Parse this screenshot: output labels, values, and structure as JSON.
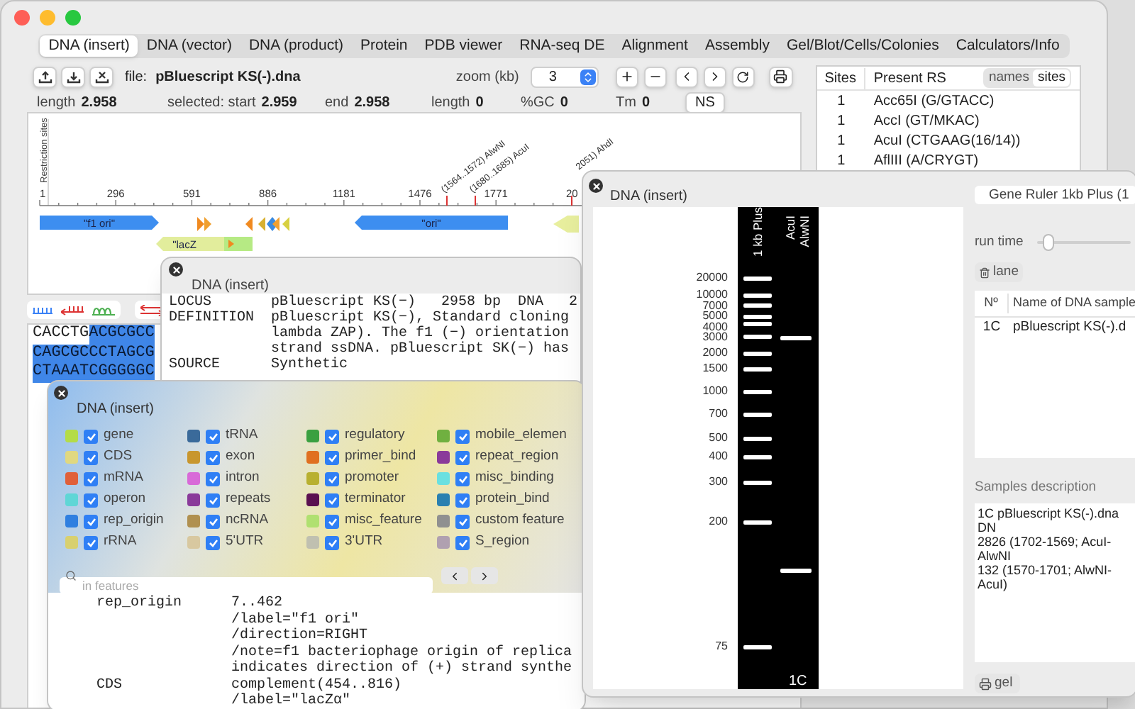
{
  "main_window": {
    "tabs": [
      {
        "label": "DNA (insert)",
        "selected": true
      },
      {
        "label": "DNA (vector)",
        "selected": false
      },
      {
        "label": "DNA (product)",
        "selected": false
      },
      {
        "label": "Protein",
        "selected": false
      },
      {
        "label": "PDB viewer",
        "selected": false
      },
      {
        "label": "RNA-seq DE",
        "selected": false
      },
      {
        "label": "Alignment",
        "selected": false
      },
      {
        "label": "Assembly",
        "selected": false
      },
      {
        "label": "Gel/Blot/Cells/Colonies",
        "selected": false
      },
      {
        "label": "Calculators/Info",
        "selected": false
      }
    ],
    "file": {
      "label": "file:",
      "name": "pBluescript KS(-).dna"
    },
    "zoom": {
      "label": "zoom (kb)",
      "value": "3"
    },
    "info": [
      {
        "label": "length",
        "value": "2.958"
      },
      {
        "label": "selected: start",
        "value": "2.959"
      },
      {
        "label": "end",
        "value": "2.958"
      },
      {
        "label": "length",
        "value": "0"
      },
      {
        "label": "%GC",
        "value": "0"
      },
      {
        "label": "Tm",
        "value": "0"
      }
    ],
    "ns_button": "NS",
    "map": {
      "axis_label": "Restriction sites",
      "ticks": [
        "1",
        "296",
        "591",
        "886",
        "1181",
        "1476",
        "1771",
        "20"
      ],
      "sites": [
        {
          "label": "(1564..1572) AlwNI"
        },
        {
          "label": "(1680..1685) AcuI"
        },
        {
          "label": "2051) AhdI"
        }
      ],
      "features": [
        {
          "label": "\"f1 ori\"",
          "color": "#3d8ef0",
          "kind": "forward"
        },
        {
          "label": "\"ori\"",
          "color": "#3d8ef0",
          "kind": "reverse"
        },
        {
          "label": "\"lacZ",
          "color": "#e2ed9c",
          "kind": "reverse"
        }
      ]
    },
    "sites_table": {
      "columns": [
        "Sites",
        "Present RS"
      ],
      "toggle": [
        {
          "label": "names",
          "selected": false
        },
        {
          "label": "sites",
          "selected": true
        }
      ],
      "rows": [
        {
          "count": "1",
          "name": "Acc65I (G/GTACC)"
        },
        {
          "count": "1",
          "name": "AccI (GT/MKAC)"
        },
        {
          "count": "1",
          "name": "AcuI (CTGAAG(16/14))"
        },
        {
          "count": "1",
          "name": "AflIII (A/CRYGT)"
        }
      ]
    },
    "sequence": [
      [
        {
          "text": "CACCTG",
          "selected": false
        },
        {
          "text": "ACGCGCC",
          "selected": true
        }
      ],
      [
        {
          "text": "CAGCGCCCTAGCG",
          "selected": true
        }
      ],
      [
        {
          "text": "CTAAATCGGGGGC",
          "selected": true
        }
      ]
    ]
  },
  "text_window": {
    "title": "DNA (insert)",
    "entries": [
      {
        "key": "LOCUS",
        "lines": [
          "pBluescript KS(−)   2958 bp  DNA   2"
        ]
      },
      {
        "key": "DEFINITION",
        "lines": [
          "pBluescript KS(−), Standard cloning",
          "lambda ZAP). The f1 (−) orientation",
          "strand ssDNA. pBluescript SK(−) has"
        ]
      },
      {
        "key": "SOURCE",
        "lines": [
          "Synthetic"
        ]
      }
    ]
  },
  "features_window": {
    "title": "DNA (insert)",
    "features": [
      {
        "label": "gene",
        "color": "#b4dc48",
        "checked": true
      },
      {
        "label": "CDS",
        "color": "#e0d880",
        "checked": true
      },
      {
        "label": "mRNA",
        "color": "#e0603a",
        "checked": true
      },
      {
        "label": "operon",
        "color": "#5fd6d6",
        "checked": true
      },
      {
        "label": "rep_origin",
        "color": "#2f7fe0",
        "checked": true
      },
      {
        "label": "rRNA",
        "color": "#d8d070",
        "checked": true
      },
      {
        "label": "tRNA",
        "color": "#3a6a9a",
        "checked": true
      },
      {
        "label": "exon",
        "color": "#c8962e",
        "checked": true
      },
      {
        "label": "intron",
        "color": "#d86ad8",
        "checked": true
      },
      {
        "label": "repeats",
        "color": "#8a3a9a",
        "checked": true
      },
      {
        "label": "ncRNA",
        "color": "#b09050",
        "checked": true
      },
      {
        "label": "5'UTR",
        "color": "#d8c8a0",
        "checked": true
      },
      {
        "label": "regulatory",
        "color": "#3aa040",
        "checked": true
      },
      {
        "label": "primer_bind",
        "color": "#e07020",
        "checked": true
      },
      {
        "label": "promoter",
        "color": "#b8b030",
        "checked": true
      },
      {
        "label": "terminator",
        "color": "#5a1050",
        "checked": true
      },
      {
        "label": "misc_feature",
        "color": "#b0e070",
        "checked": true
      },
      {
        "label": "3'UTR",
        "color": "#c0c0b0",
        "checked": true
      },
      {
        "label": "mobile_elemen",
        "color": "#70b040",
        "checked": true
      },
      {
        "label": "repeat_region",
        "color": "#8a3a9a",
        "checked": true
      },
      {
        "label": "misc_binding",
        "color": "#6ae0e0",
        "checked": true
      },
      {
        "label": "protein_bind",
        "color": "#2a80b0",
        "checked": true
      },
      {
        "label": "custom feature",
        "color": "#909090",
        "checked": true
      },
      {
        "label": "S_region",
        "color": "#b0a0b0",
        "checked": true
      }
    ],
    "search": {
      "placeholder": "in features"
    },
    "entries": [
      {
        "key": "rep_origin",
        "lines": [
          "7..462",
          "/label=\"f1 ori\"",
          "/direction=RIGHT",
          "/note=f1 bacteriophage origin of replica",
          "indicates direction of (+) strand synthe"
        ]
      },
      {
        "key": "CDS",
        "lines": [
          "complement(454..816)",
          "/label=\"lacZα\""
        ]
      }
    ]
  },
  "gel_window": {
    "title": "DNA (insert)",
    "ladder_menu": "Gene Ruler 1kb Plus (1",
    "run_time": {
      "label": "run time",
      "level": 0.12
    },
    "lane_button": "lane",
    "ladder_sizes": [
      "20000",
      "10000",
      "7000",
      "5000",
      "4000",
      "3000",
      "2000",
      "1500",
      "1000",
      "700",
      "500",
      "400",
      "300",
      "200",
      "75"
    ],
    "lanes": [
      {
        "kind": "ladder",
        "label": "1 kb Plus"
      },
      {
        "kind": "sample",
        "label": "AcuI AlwNI",
        "footer": "1C"
      }
    ],
    "table": {
      "columns": [
        "Nº",
        "Name of DNA sample"
      ],
      "rows": [
        {
          "number": "1C",
          "name": "pBluescript KS(-).d"
        }
      ]
    },
    "description_label": "Samples description",
    "description": [
      "1C pBluescript KS(-).dna DN",
      "2826 (1702-1569; AcuI-AlwNI",
      "132 (1570-1701; AlwNI-AcuI)"
    ],
    "gel_button": "gel"
  }
}
